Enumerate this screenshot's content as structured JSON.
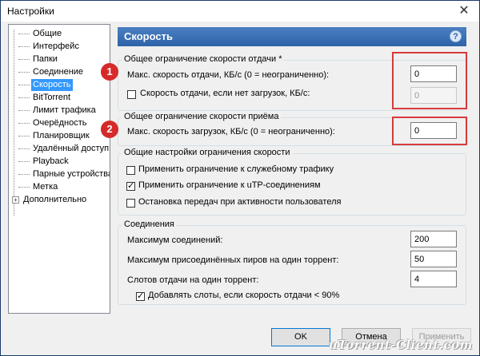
{
  "window": {
    "title": "Настройки",
    "close_glyph": "✕"
  },
  "tree": {
    "items": [
      {
        "label": "Общие"
      },
      {
        "label": "Интерфейс"
      },
      {
        "label": "Папки"
      },
      {
        "label": "Соединение"
      },
      {
        "label": "Скорость",
        "selected": true
      },
      {
        "label": "BitTorrent"
      },
      {
        "label": "Лимит трафика"
      },
      {
        "label": "Очерёдность"
      },
      {
        "label": "Планировщик"
      },
      {
        "label": "Удалённый доступ"
      },
      {
        "label": "Playback"
      },
      {
        "label": "Парные устройства"
      },
      {
        "label": "Метка"
      },
      {
        "label": "Дополнительно",
        "expandable": true
      }
    ],
    "expander_glyph": "+"
  },
  "header": {
    "title": "Скорость",
    "help_glyph": "?"
  },
  "upload": {
    "group_title": "Общее ограничение скорости отдачи *",
    "max_label": "Макс. скорость отдачи, КБ/с (0 = неограниченно):",
    "max_value": "0",
    "no_download_label": "Скорость отдачи, если нет загрузок, КБ/с:",
    "no_download_checked": false,
    "no_download_value": "0"
  },
  "download": {
    "group_title": "Общее ограничение скорости приёма",
    "max_label": "Макс. скорость загрузок, КБ/с (0 = неограниченно):",
    "max_value": "0"
  },
  "general": {
    "group_title": "Общие настройки ограничения скорости",
    "options": [
      {
        "label": "Применить ограничение к служебному трафику",
        "checked": false
      },
      {
        "label": "Применить ограничение к uTP-соединениям",
        "checked": true
      },
      {
        "label": "Остановка передач при активности пользователя",
        "checked": false
      }
    ]
  },
  "connections": {
    "group_title": "Соединения",
    "max_conn_label": "Максимум соединений:",
    "max_conn_value": "200",
    "max_peers_label": "Максимум присоединённых пиров на один торрент:",
    "max_peers_value": "50",
    "slots_label": "Слотов отдачи на один торрент:",
    "slots_value": "4",
    "add_slots_label": "Добавлять слоты, если скорость отдачи < 90%",
    "add_slots_checked": true
  },
  "badges": [
    "1",
    "2"
  ],
  "buttons": {
    "ok": "OK",
    "cancel": "Отмена",
    "apply": "Применить"
  },
  "watermark": "uTorrent-Client.com",
  "colors": {
    "header": "#2e63a8",
    "selection": "#3399ff",
    "highlight": "#d73a3a"
  }
}
